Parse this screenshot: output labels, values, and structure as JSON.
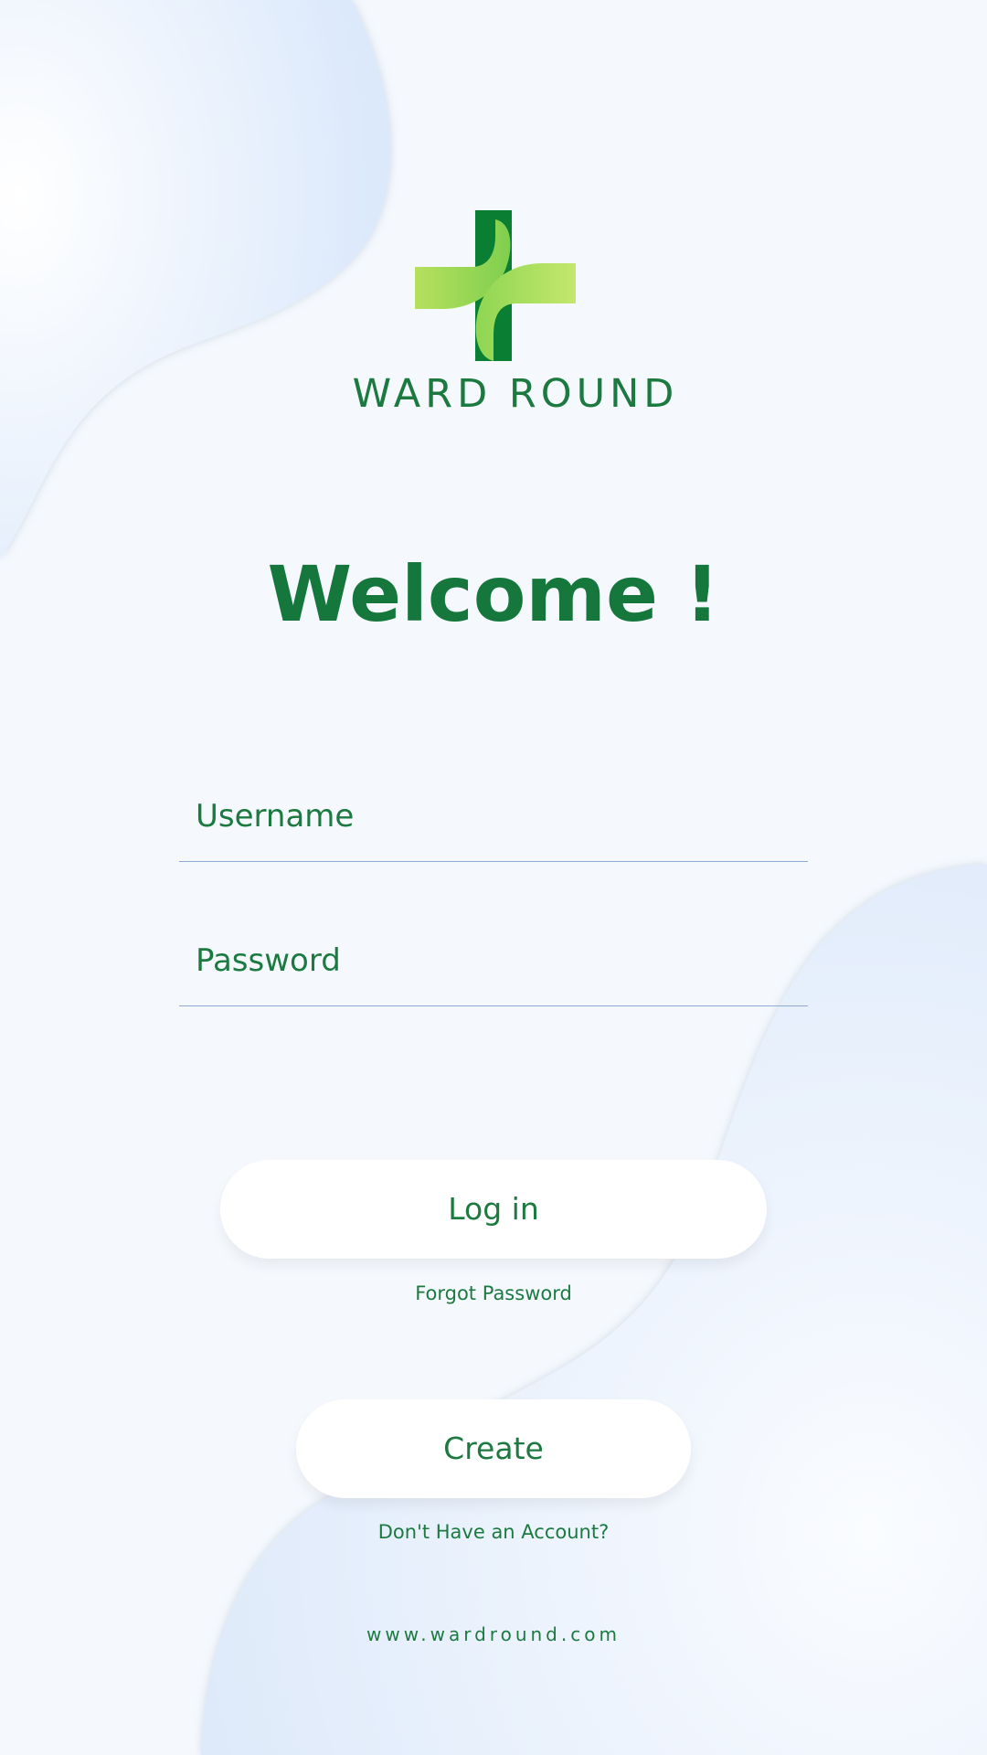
{
  "brand": {
    "name": "WARD ROUND",
    "logo_icon": "medical-cross-icon",
    "colors": {
      "dark_green": "#0a7f34",
      "light_green": "#bfe36a",
      "text_green": "#1c7a41"
    }
  },
  "welcome": {
    "title": "Welcome !"
  },
  "form": {
    "username_placeholder": "Username",
    "username_value": "",
    "password_placeholder": "Password",
    "password_value": ""
  },
  "actions": {
    "login_label": "Log in",
    "forgot_label": "Forgot Password",
    "create_label": "Create",
    "no_account_label": "Don't Have an Account?"
  },
  "footer": {
    "website": "www.wardround.com"
  },
  "theme": {
    "background": "#f5f9fe",
    "blob": "#e1edfc"
  }
}
